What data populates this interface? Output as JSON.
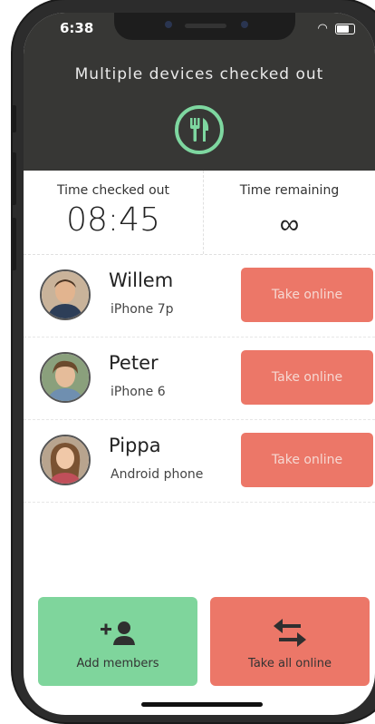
{
  "status_bar": {
    "time": "6:38"
  },
  "header": {
    "title": "Multiple devices checked out",
    "icon": "cutlery-icon"
  },
  "stats": {
    "checked_out_label": "Time checked out",
    "checked_out_value": "08:45",
    "remaining_label": "Time remaining",
    "remaining_value": "∞"
  },
  "members": [
    {
      "name": "Willem",
      "device": "iPhone 7p",
      "action": "Take online"
    },
    {
      "name": "Peter",
      "device": "iPhone 6",
      "action": "Take online"
    },
    {
      "name": "Pippa",
      "device": "Android phone",
      "action": "Take online"
    }
  ],
  "footer": {
    "add_members_label": "Add members",
    "take_all_label": "Take all online"
  },
  "colors": {
    "header_bg": "#373735",
    "accent_green": "#7fd59c",
    "accent_red": "#ec7768"
  }
}
